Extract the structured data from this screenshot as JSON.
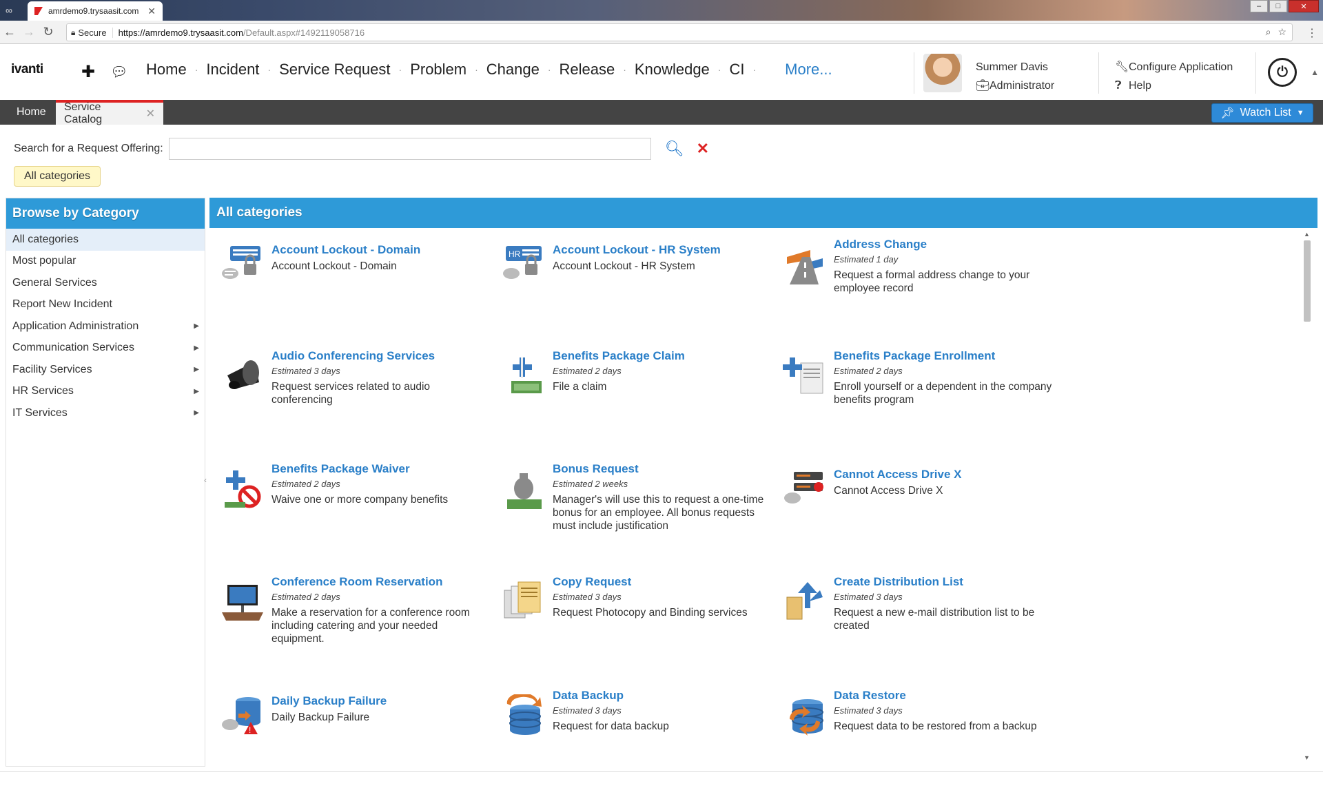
{
  "browser": {
    "tab_title": "amrdemo9.trysaasit.com",
    "secure_label": "Secure",
    "url_host": "https://amrdemo9.trysaasit.com",
    "url_path": "/Default.aspx#1492119058716"
  },
  "header": {
    "logo": "ivanti",
    "nav": [
      "Home",
      "Incident",
      "Service Request",
      "Problem",
      "Change",
      "Release",
      "Knowledge",
      "CI"
    ],
    "more": "More...",
    "user_name": "Summer Davis",
    "user_role": "Administrator",
    "configure": "Configure Application",
    "help": "Help"
  },
  "tabs": {
    "home": "Home",
    "active": "Service Catalog",
    "watch_list": "Watch List"
  },
  "search": {
    "label": "Search for a Request Offering:",
    "value": "",
    "chip": "All categories"
  },
  "sidebar": {
    "title": "Browse by Category",
    "items": [
      {
        "label": "All categories",
        "selected": true,
        "has_children": false
      },
      {
        "label": "Most popular",
        "selected": false,
        "has_children": false
      },
      {
        "label": "General Services",
        "selected": false,
        "has_children": false
      },
      {
        "label": "Report New Incident",
        "selected": false,
        "has_children": false
      },
      {
        "label": "Application Administration",
        "selected": false,
        "has_children": true
      },
      {
        "label": "Communication Services",
        "selected": false,
        "has_children": true
      },
      {
        "label": "Facility Services",
        "selected": false,
        "has_children": true
      },
      {
        "label": "HR Services",
        "selected": false,
        "has_children": true
      },
      {
        "label": "IT Services",
        "selected": false,
        "has_children": true
      }
    ]
  },
  "main": {
    "title": "All categories",
    "offerings": [
      {
        "title": "Account Lockout - Domain",
        "est": "",
        "desc": "Account Lockout - Domain",
        "icon": "server-lock-icon"
      },
      {
        "title": "Account Lockout - HR System",
        "est": "",
        "desc": "Account Lockout - HR System",
        "icon": "hr-server-lock-icon"
      },
      {
        "title": "Address Change",
        "est": "Estimated 1 day",
        "desc": "Request a formal address change to your employee record",
        "icon": "road-sign-icon"
      },
      {
        "title": "Audio Conferencing Services",
        "est": "Estimated 3 days",
        "desc": "Request services related to audio conferencing",
        "icon": "conference-phone-icon"
      },
      {
        "title": "Benefits Package Claim",
        "est": "Estimated 2 days",
        "desc": "File a claim",
        "icon": "medical-money-icon"
      },
      {
        "title": "Benefits Package Enrollment",
        "est": "Estimated 2 days",
        "desc": "Enroll yourself or a dependent in the company benefits program",
        "icon": "medical-document-icon"
      },
      {
        "title": "Benefits Package Waiver",
        "est": "Estimated 2 days",
        "desc": "Waive one or more company benefits",
        "icon": "medical-no-icon"
      },
      {
        "title": "Bonus Request",
        "est": "Estimated 2 weeks",
        "desc": "Manager's will use this to request a one-time bonus for an employee. All bonus requests must include justification",
        "icon": "money-bag-icon"
      },
      {
        "title": "Cannot Access Drive X",
        "est": "",
        "desc": "Cannot Access Drive X",
        "icon": "drive-error-icon"
      },
      {
        "title": "Conference Room Reservation",
        "est": "Estimated 2 days",
        "desc": "Make a reservation for a conference room including catering and your needed equipment.",
        "icon": "conference-room-icon"
      },
      {
        "title": "Copy Request",
        "est": "Estimated 3 days",
        "desc": "Request Photocopy and Binding services",
        "icon": "copy-documents-icon"
      },
      {
        "title": "Create Distribution List",
        "est": "Estimated 3 days",
        "desc": "Request a new e-mail distribution list to be created",
        "icon": "distribution-list-icon"
      },
      {
        "title": "Daily Backup Failure",
        "est": "",
        "desc": "Daily Backup Failure",
        "icon": "database-warning-icon"
      },
      {
        "title": "Data Backup",
        "est": "Estimated 3 days",
        "desc": "Request for data backup",
        "icon": "database-backup-icon"
      },
      {
        "title": "Data Restore",
        "est": "Estimated 3 days",
        "desc": "Request data to be restored from a backup",
        "icon": "database-restore-icon"
      }
    ]
  }
}
